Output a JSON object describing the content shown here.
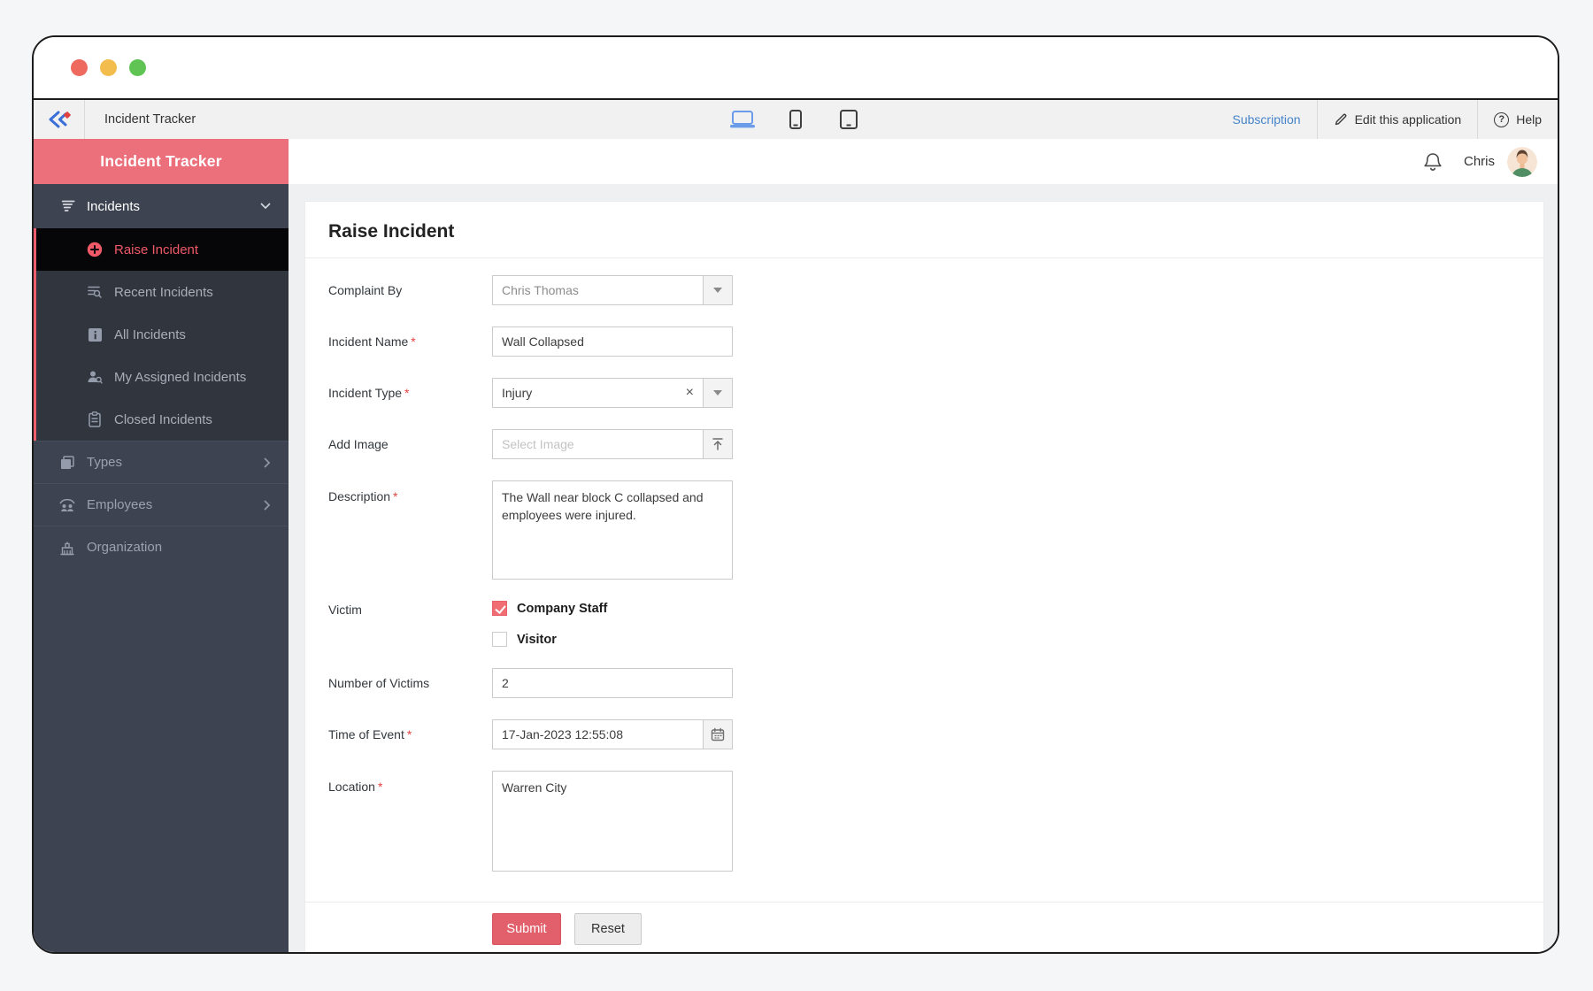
{
  "window": {
    "traffic_light_colors": [
      "#ee6a5f",
      "#f3bd4e",
      "#5fc454"
    ]
  },
  "toolbar": {
    "app_title": "Incident Tracker",
    "subscription": "Subscription",
    "edit_application": "Edit this application",
    "help": "Help",
    "device_icons": [
      "laptop",
      "phone",
      "tablet"
    ],
    "active_device": "laptop"
  },
  "sidebar": {
    "header_title": "Incident Tracker",
    "incidents_parent": {
      "label": "Incidents",
      "expanded": true
    },
    "submenu": [
      {
        "label": "Raise Incident",
        "icon": "plus-circle",
        "active": true
      },
      {
        "label": "Recent Incidents",
        "icon": "list-search",
        "active": false
      },
      {
        "label": "All Incidents",
        "icon": "info-square",
        "active": false
      },
      {
        "label": "My Assigned Incidents",
        "icon": "person-search",
        "active": false
      },
      {
        "label": "Closed Incidents",
        "icon": "clipboard",
        "active": false
      }
    ],
    "items": [
      {
        "label": "Types",
        "icon": "stacked-squares",
        "has_chevron": true
      },
      {
        "label": "Employees",
        "icon": "people",
        "has_chevron": true
      },
      {
        "label": "Organization",
        "icon": "building",
        "has_chevron": false
      }
    ],
    "accent_color": "#ec6f7c",
    "active_text_color": "#ef5968"
  },
  "user": {
    "name": "Chris"
  },
  "form": {
    "title": "Raise Incident",
    "required_marker": "*",
    "fields": {
      "complaint_by": {
        "label": "Complaint By",
        "value": "Chris Thomas",
        "required": false
      },
      "incident_name": {
        "label": "Incident Name",
        "value": "Wall Collapsed",
        "required": true
      },
      "incident_type": {
        "label": "Incident Type",
        "value": "Injury",
        "required": true
      },
      "add_image": {
        "label": "Add Image",
        "placeholder": "Select Image",
        "required": false
      },
      "description": {
        "label": "Description",
        "value": "The Wall near block C collapsed and employees were injured.",
        "required": true
      },
      "victim": {
        "label": "Victim",
        "options": [
          {
            "label": "Company Staff",
            "checked": true
          },
          {
            "label": "Visitor",
            "checked": false
          }
        ]
      },
      "number_of_victims": {
        "label": "Number of Victims",
        "value": "2",
        "required": false
      },
      "time_of_event": {
        "label": "Time of Event",
        "value": "17-Jan-2023 12:55:08",
        "required": true
      },
      "location": {
        "label": "Location",
        "value": "Warren City",
        "required": true
      }
    },
    "buttons": {
      "submit": "Submit",
      "reset": "Reset"
    },
    "submit_color": "#e2606b"
  }
}
